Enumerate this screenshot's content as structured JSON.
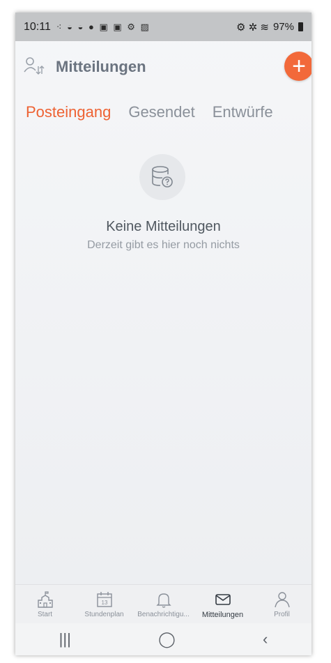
{
  "status_bar": {
    "time": "10:11",
    "notification_icons": "⁖ ◒ ◒ ● ▣ ▣ ⚙ ▨",
    "system_icons": "⚙ ✲ ≋",
    "battery": "97%"
  },
  "header": {
    "title": "Mitteilungen",
    "add_button_label": "+"
  },
  "tabs": [
    {
      "label": "Posteingang",
      "active": true
    },
    {
      "label": "Gesendet",
      "active": false
    },
    {
      "label": "Entwürfe",
      "active": false
    }
  ],
  "empty_state": {
    "title": "Keine Mitteilungen",
    "subtitle": "Derzeit gibt es hier noch nichts"
  },
  "bottom_nav": [
    {
      "label": "Start",
      "icon": "school-icon"
    },
    {
      "label": "Stundenplan",
      "icon": "calendar-icon",
      "calendar_day": "13"
    },
    {
      "label": "Benachrichtigu...",
      "icon": "bell-icon"
    },
    {
      "label": "Mitteilungen",
      "icon": "envelope-icon",
      "active": true
    },
    {
      "label": "Profil",
      "icon": "person-icon"
    }
  ],
  "system_nav": {
    "recents": "|||",
    "home": "◯",
    "back": "‹"
  },
  "colors": {
    "accent": "#ee6233",
    "fab": "#f2693a",
    "muted_text": "#8a9099"
  }
}
